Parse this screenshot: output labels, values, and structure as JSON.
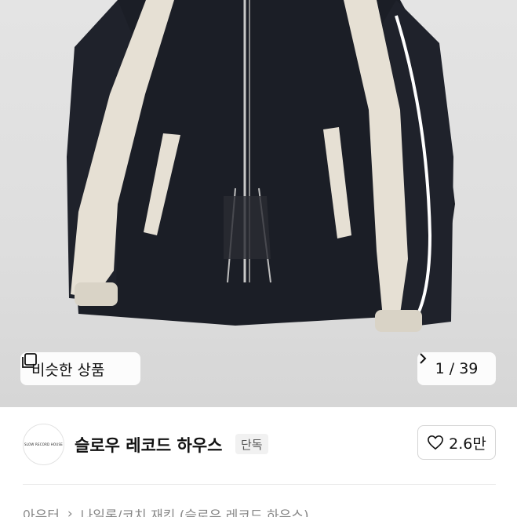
{
  "product_image": {
    "alt": "",
    "similar_button": {
      "label": "비슷한 상품",
      "icon": "similar-items-icon"
    },
    "counter": {
      "current": "1",
      "total": "39",
      "text": "1 / 39",
      "icon": "chevron-right-icon"
    }
  },
  "store": {
    "logo_text": "SLOW RECORD HOUSE",
    "name": "슬로우 레코드 하우스",
    "badge": "단독",
    "like": {
      "count": "2.6만",
      "icon": "heart-icon"
    }
  },
  "breadcrumb": {
    "items": [
      "아우터",
      "나일론/코치 재킷 (슬로우 레코드 하우스)"
    ],
    "separator": "›"
  },
  "colors": {
    "jacket_body": "#1b1e26",
    "jacket_panel": "#e6e0d4",
    "background": "#e0e0e0"
  }
}
